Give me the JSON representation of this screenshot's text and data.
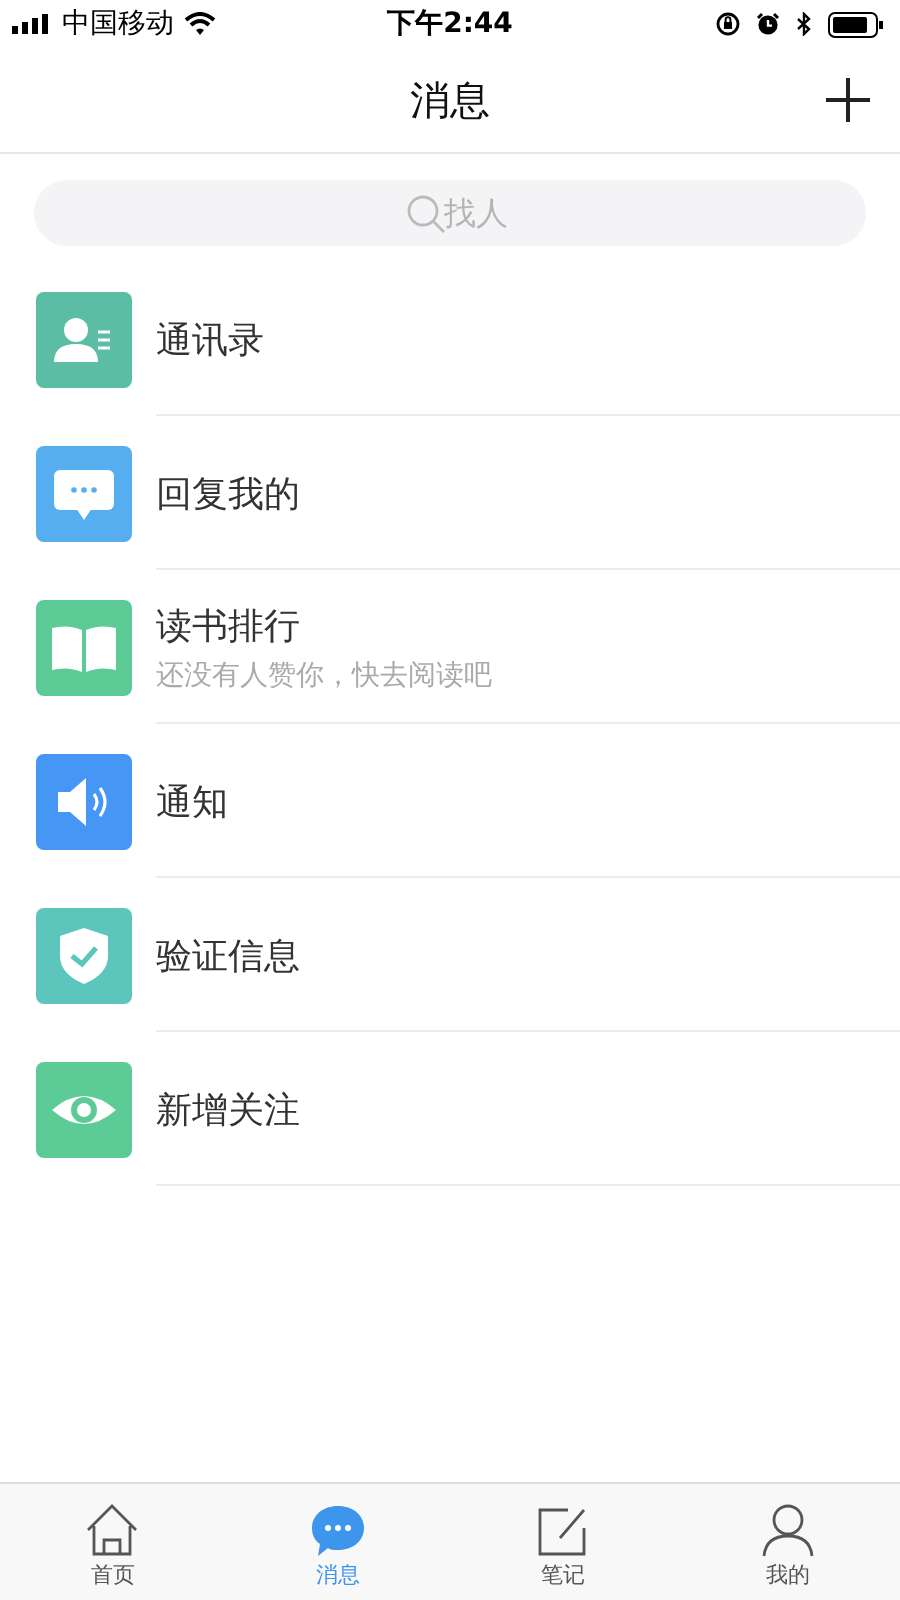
{
  "status_bar": {
    "carrier": "中国移动",
    "time": "下午2:44"
  },
  "header": {
    "title": "消息"
  },
  "search": {
    "placeholder": "找人"
  },
  "items": [
    {
      "kind": "contacts",
      "color": "#5cbda5",
      "title": "通讯录"
    },
    {
      "kind": "reply",
      "color": "#56aef0",
      "title": "回复我的"
    },
    {
      "kind": "book",
      "color": "#5ccb96",
      "title": "读书排行",
      "subtitle": "还没有人赞你，快去阅读吧"
    },
    {
      "kind": "notice",
      "color": "#4596f5",
      "title": "通知"
    },
    {
      "kind": "verify",
      "color": "#5cc6bd",
      "title": "验证信息"
    },
    {
      "kind": "follow",
      "color": "#5ccb96",
      "title": "新增关注"
    }
  ],
  "tabs": [
    {
      "kind": "home",
      "label": "首页",
      "selected": false
    },
    {
      "kind": "messages",
      "label": "消息",
      "selected": true
    },
    {
      "kind": "notes",
      "label": "笔记",
      "selected": false
    },
    {
      "kind": "profile",
      "label": "我的",
      "selected": false
    }
  ]
}
